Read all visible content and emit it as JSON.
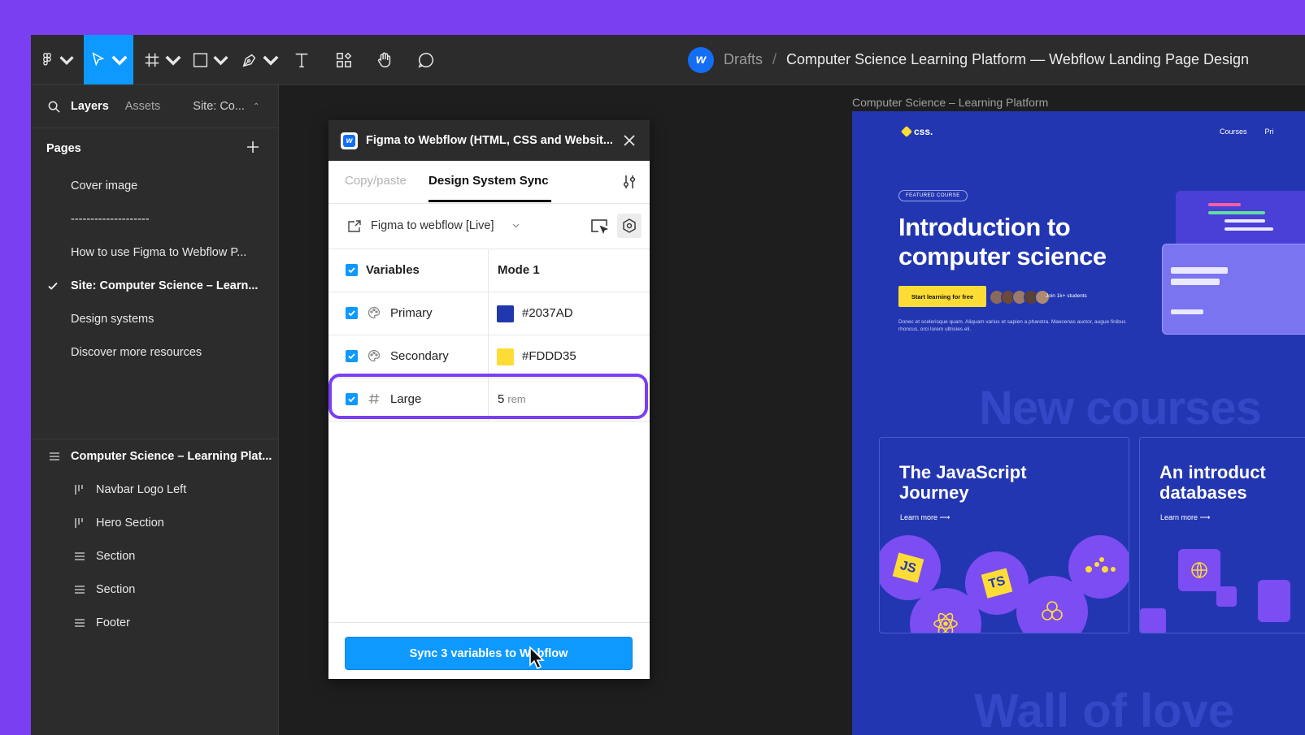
{
  "toolbar": {
    "tools": [
      "figma-menu",
      "move",
      "frame",
      "rectangle",
      "pen",
      "text",
      "resources",
      "hand",
      "comment"
    ]
  },
  "breadcrumb": {
    "drafts": "Drafts",
    "separator": "/",
    "file": "Computer Science Learning Platform — Webflow Landing Page Design"
  },
  "sidebar": {
    "tabs": {
      "layers": "Layers",
      "assets": "Assets"
    },
    "site_selector": "Site: Co...",
    "pages_title": "Pages",
    "pages": [
      {
        "label": "Cover image"
      },
      {
        "label": "--------------------"
      },
      {
        "label": "How to use Figma to Webflow P..."
      },
      {
        "label": "Site: Computer Science – Learn...",
        "active": true
      },
      {
        "label": "Design systems"
      },
      {
        "label": "Discover more resources"
      }
    ],
    "layers": [
      {
        "label": "Computer Science – Learning Plat...",
        "icon": "section-icon"
      },
      {
        "label": "Navbar Logo Left",
        "icon": "columns-icon"
      },
      {
        "label": "Hero Section",
        "icon": "columns-icon"
      },
      {
        "label": "Section",
        "icon": "section-icon"
      },
      {
        "label": "Section",
        "icon": "section-icon"
      },
      {
        "label": "Footer",
        "icon": "section-icon"
      }
    ]
  },
  "plugin": {
    "title": "Figma to Webflow (HTML, CSS and Websit...",
    "tabs": {
      "copy": "Copy/paste",
      "sync": "Design System Sync"
    },
    "project": "Figma to webflow [Live]",
    "table": {
      "header_variables": "Variables",
      "header_mode": "Mode 1",
      "rows": [
        {
          "name": "Primary",
          "type": "color",
          "value": "#2037AD",
          "swatch": "#2037AD"
        },
        {
          "name": "Secondary",
          "type": "color",
          "value": "#FDDD35",
          "swatch": "#FDDD35"
        },
        {
          "name": "Large",
          "type": "number",
          "value": "5",
          "unit": "rem"
        }
      ]
    },
    "sync_button": "Sync 3 variables to Webflow"
  },
  "canvas": {
    "frame_label": "Computer Science – Learning Platform",
    "landing": {
      "logo": "css.",
      "nav": [
        "Courses",
        "Pri"
      ],
      "badge": "FEATURED COURSE",
      "title": "Introduction to computer science",
      "cta": "Start learning for free",
      "students": "Join 1k+ students",
      "desc": "Donec et scelerisque quam. Aliquam varius et sapien a pharetra. Maecenas auctor, augue finibus rhoncus, orci lorem ultricies eli.",
      "new_courses": "New courses",
      "cards": [
        {
          "title": "The JavaScript\nJourney",
          "learn": "Learn more ⟶"
        },
        {
          "title": "An introduct\ndatabases",
          "learn": "Learn more ⟶"
        }
      ],
      "wall": "Wall of love"
    }
  },
  "colors": {
    "brand_purple": "#7b3ff2",
    "accent_blue": "#0d99ff",
    "primary": "#2037AD",
    "secondary": "#FDDD35"
  }
}
